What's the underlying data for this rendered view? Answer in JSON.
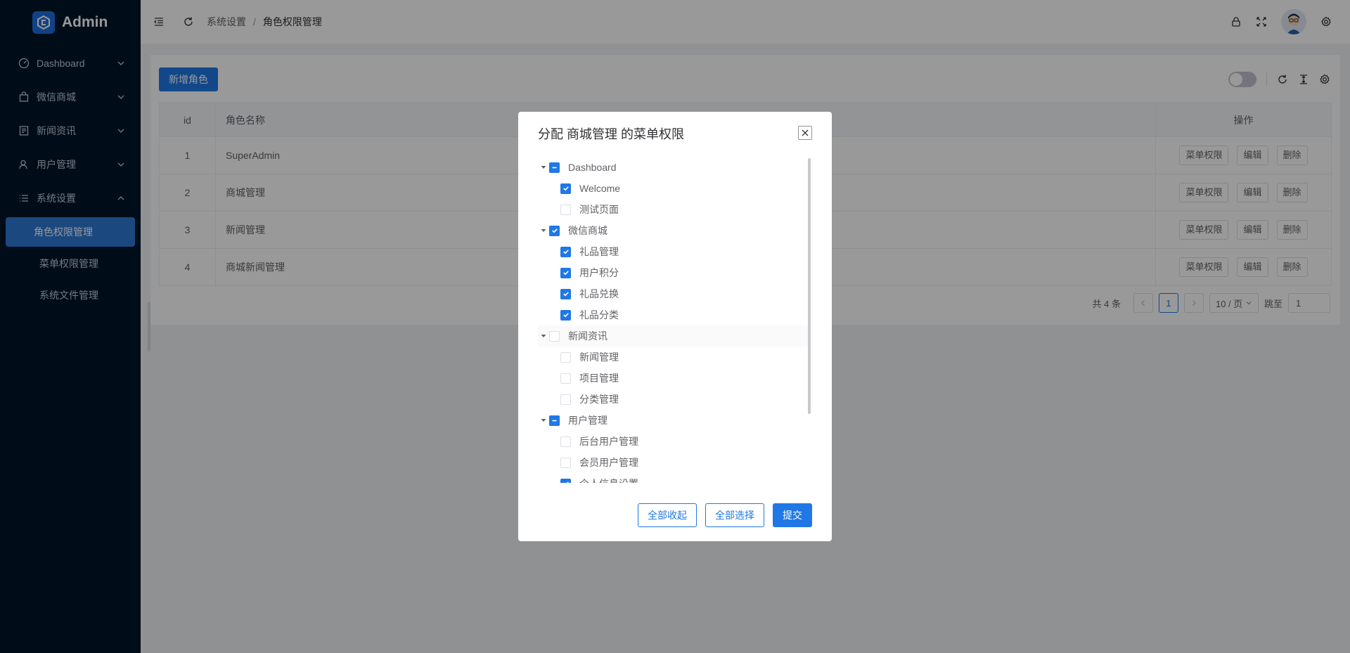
{
  "app": {
    "name": "Admin"
  },
  "sidebar": {
    "items": [
      {
        "label": "Dashboard",
        "icon": "dashboard-icon",
        "expanded": false
      },
      {
        "label": "微信商城",
        "icon": "shopping-bag-icon",
        "expanded": false
      },
      {
        "label": "新闻资讯",
        "icon": "news-icon",
        "expanded": false
      },
      {
        "label": "用户管理",
        "icon": "user-icon",
        "expanded": false
      },
      {
        "label": "系统设置",
        "icon": "list-icon",
        "expanded": true
      }
    ],
    "subitems": [
      {
        "label": "角色权限管理",
        "active": true
      },
      {
        "label": "菜单权限管理",
        "active": false
      },
      {
        "label": "系统文件管理",
        "active": false
      }
    ]
  },
  "header": {
    "breadcrumb": [
      "系统设置",
      "角色权限管理"
    ],
    "separator": "/"
  },
  "toolbar": {
    "add_label": "新增角色"
  },
  "table": {
    "columns": [
      "id",
      "角色名称",
      "操作"
    ],
    "rows": [
      {
        "id": "1",
        "name": "SuperAdmin"
      },
      {
        "id": "2",
        "name": "商城管理"
      },
      {
        "id": "3",
        "name": "新闻管理"
      },
      {
        "id": "4",
        "name": "商城新闻管理"
      }
    ],
    "actions": {
      "menu": "菜单权限",
      "edit": "编辑",
      "delete": "删除"
    }
  },
  "pagination": {
    "total": "共 4 条",
    "current": "1",
    "page_size": "10 / 页",
    "jump_label": "跳至",
    "jump_value": "1"
  },
  "dialog": {
    "title": "分配 商城管理 的菜单权限",
    "tree": [
      {
        "label": "Dashboard",
        "level": 1,
        "state": "indeterminate"
      },
      {
        "label": "Welcome",
        "level": 2,
        "state": "checked"
      },
      {
        "label": "测试页面",
        "level": 2,
        "state": "unchecked"
      },
      {
        "label": "微信商城",
        "level": 1,
        "state": "checked"
      },
      {
        "label": "礼品管理",
        "level": 2,
        "state": "checked"
      },
      {
        "label": "用户积分",
        "level": 2,
        "state": "checked"
      },
      {
        "label": "礼品兑换",
        "level": 2,
        "state": "checked"
      },
      {
        "label": "礼品分类",
        "level": 2,
        "state": "checked"
      },
      {
        "label": "新闻资讯",
        "level": 1,
        "state": "unchecked"
      },
      {
        "label": "新闻管理",
        "level": 2,
        "state": "unchecked"
      },
      {
        "label": "项目管理",
        "level": 2,
        "state": "unchecked"
      },
      {
        "label": "分类管理",
        "level": 2,
        "state": "unchecked"
      },
      {
        "label": "用户管理",
        "level": 1,
        "state": "indeterminate"
      },
      {
        "label": "后台用户管理",
        "level": 2,
        "state": "unchecked"
      },
      {
        "label": "会员用户管理",
        "level": 2,
        "state": "unchecked"
      },
      {
        "label": "个人信息设置",
        "level": 2,
        "state": "checked"
      }
    ],
    "buttons": {
      "collapse_all": "全部收起",
      "select_all": "全部选择",
      "submit": "提交"
    }
  },
  "colors": {
    "sidebar_bg": "#001529",
    "primary": "#1f78e6",
    "overlay": "rgba(0,0,0,0.40)"
  }
}
